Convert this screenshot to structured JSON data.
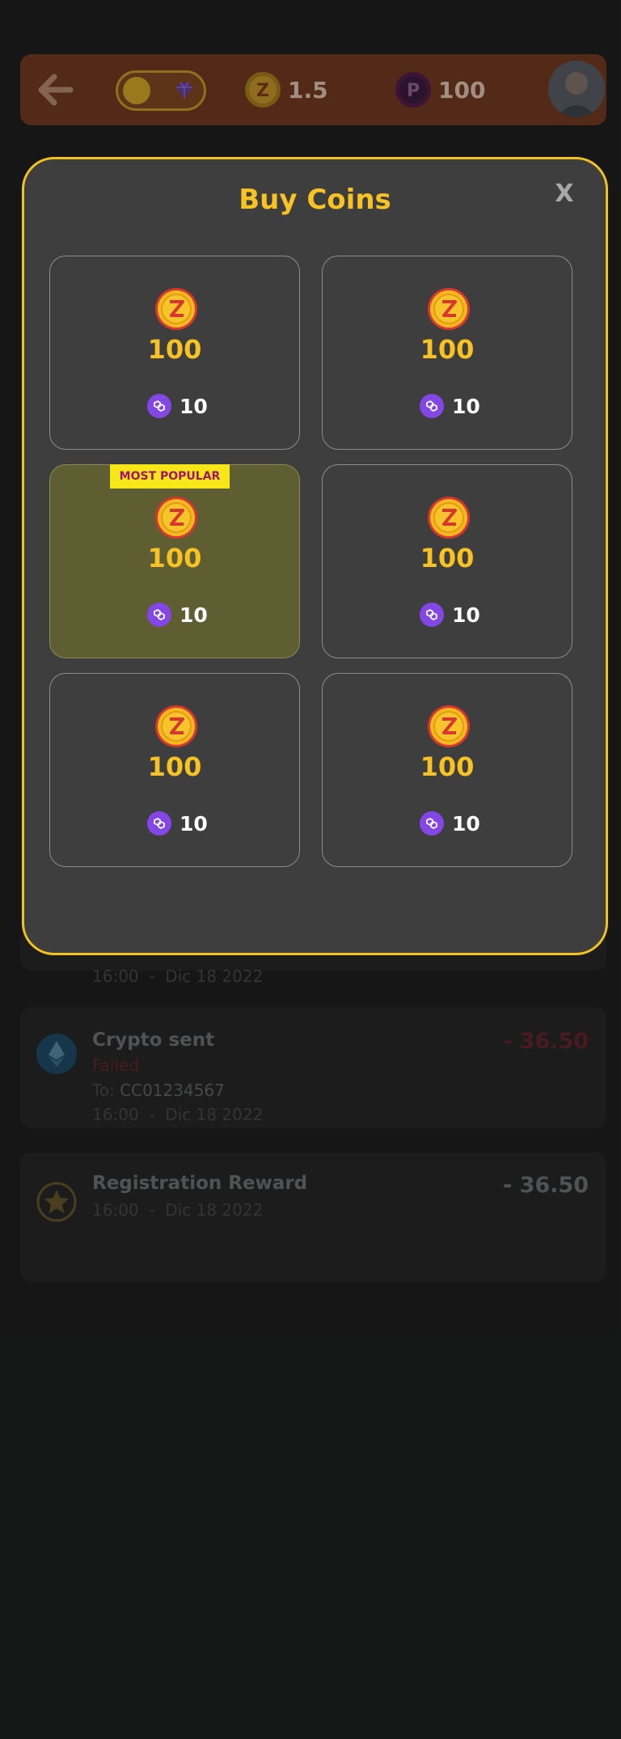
{
  "header": {
    "coin_balance": "1.5",
    "points_balance": "100"
  },
  "transactions": [
    {
      "title": "Crypto sent",
      "status": "Failed",
      "to_label": "To:",
      "to_value": "CC01234567",
      "time": "16:00",
      "separator": "-",
      "date": "Dic 18 2022",
      "amount": "- 36.50",
      "amount_color": "#6b2233",
      "icon": "ethereum-icon"
    },
    {
      "title": "Registration Reward",
      "time": "16:00",
      "separator": "-",
      "date": "Dic 18 2022",
      "amount": "- 36.50",
      "amount_color": "#77787a",
      "icon": "star-icon"
    }
  ],
  "partial_row": {
    "time": "16:00",
    "separator": "-",
    "date": "Dic 18 2022"
  },
  "modal": {
    "title": "Buy Coins",
    "close_label": "X",
    "badge_label": "MOST POPULAR",
    "packages": [
      {
        "amount": "100",
        "price": "10",
        "popular": false
      },
      {
        "amount": "100",
        "price": "10",
        "popular": false
      },
      {
        "amount": "100",
        "price": "10",
        "popular": true
      },
      {
        "amount": "100",
        "price": "10",
        "popular": false
      },
      {
        "amount": "100",
        "price": "10",
        "popular": false
      },
      {
        "amount": "100",
        "price": "10",
        "popular": false
      }
    ]
  },
  "colors": {
    "accent": "#f7c223",
    "modal_border": "#f2c21e",
    "badge_bg": "#f7e719",
    "badge_text": "#a2166a",
    "polygon": "#8247e5"
  }
}
